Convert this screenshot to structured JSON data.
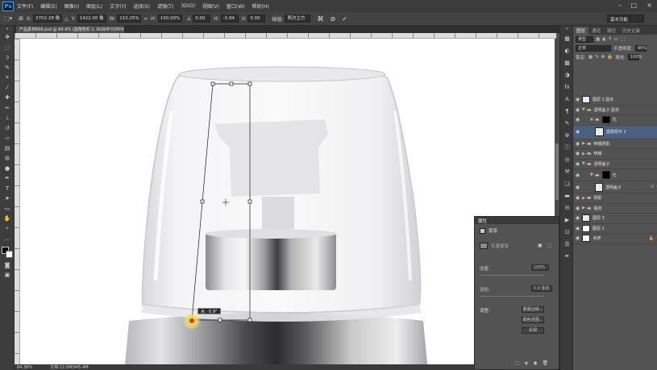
{
  "app": {
    "logo": "Ps"
  },
  "menu": [
    "文件(F)",
    "编辑(E)",
    "图像(I)",
    "图层(L)",
    "文字(Y)",
    "选择(S)",
    "滤镜(T)",
    "3D(D)",
    "视图(V)",
    "窗口(W)",
    "帮助(H)"
  ],
  "window_controls": {
    "minimize": "–",
    "maximize": "□",
    "close": "×"
  },
  "options": {
    "x_label": "X:",
    "x_value": "2702.28 像",
    "y_label": "Y:",
    "y_value": "1422.00 像",
    "w_label": "W:",
    "w_value": "110.25%",
    "h_label": "H:",
    "h_value": "100.00%",
    "angle_value": "0.00",
    "hskew_label": "H:",
    "hskew_value": "-5.94",
    "vskew_label": "V:",
    "vskew_value": "0.00",
    "interp_label": "插值:",
    "interp_value": "两次立方",
    "workspace": "基本功能"
  },
  "document": {
    "tab_title": "产品素材666.psd @ 84.4% (圆角矩形 2, RGB/8*/CMYK) *",
    "zoom": "84.38%",
    "doc_info": "文档:12.0M/945.4M",
    "transform_tip": "水: -5.9°"
  },
  "layers_panel": {
    "tabs": [
      "图层",
      "通道",
      "路径",
      "历史记录"
    ],
    "kind_label": "类型",
    "blend_mode": "正常",
    "opacity_label": "不透明度:",
    "opacity_value": "90%",
    "lock_label": "锁定:",
    "fill_label": "填充:",
    "fill_value": "100%",
    "items": [
      {
        "name": "图层 3 副本",
        "type": "pixel"
      },
      {
        "name": "透明盖子 副本",
        "type": "group"
      },
      {
        "name": "光",
        "type": "mask"
      },
      {
        "name": "圆角矩形 2",
        "type": "shape"
      },
      {
        "name": "喷嘴阴影",
        "type": "group"
      },
      {
        "name": "喷嘴",
        "type": "group"
      },
      {
        "name": "透明盖子",
        "type": "group"
      },
      {
        "name": "光",
        "type": "mask"
      },
      {
        "name": "透明盖子",
        "type": "pixel"
      },
      {
        "name": "阴影",
        "type": "group"
      },
      {
        "name": "瓶身",
        "type": "group"
      },
      {
        "name": "图层 3",
        "type": "pixel"
      },
      {
        "name": "图层 2",
        "type": "pixel"
      },
      {
        "name": "背景",
        "type": "pixel"
      }
    ]
  },
  "properties_panel": {
    "title": "属性",
    "section": "蒙版",
    "mask_type": "矢量蒙版",
    "density_label": "浓度:",
    "density_value": "100%",
    "feather_label": "羽化:",
    "feather_value": "0.0 像素",
    "refine_label": "调整:",
    "btn_edge": "蒙版边缘...",
    "btn_color": "颜色范围...",
    "btn_invert": "反相"
  }
}
